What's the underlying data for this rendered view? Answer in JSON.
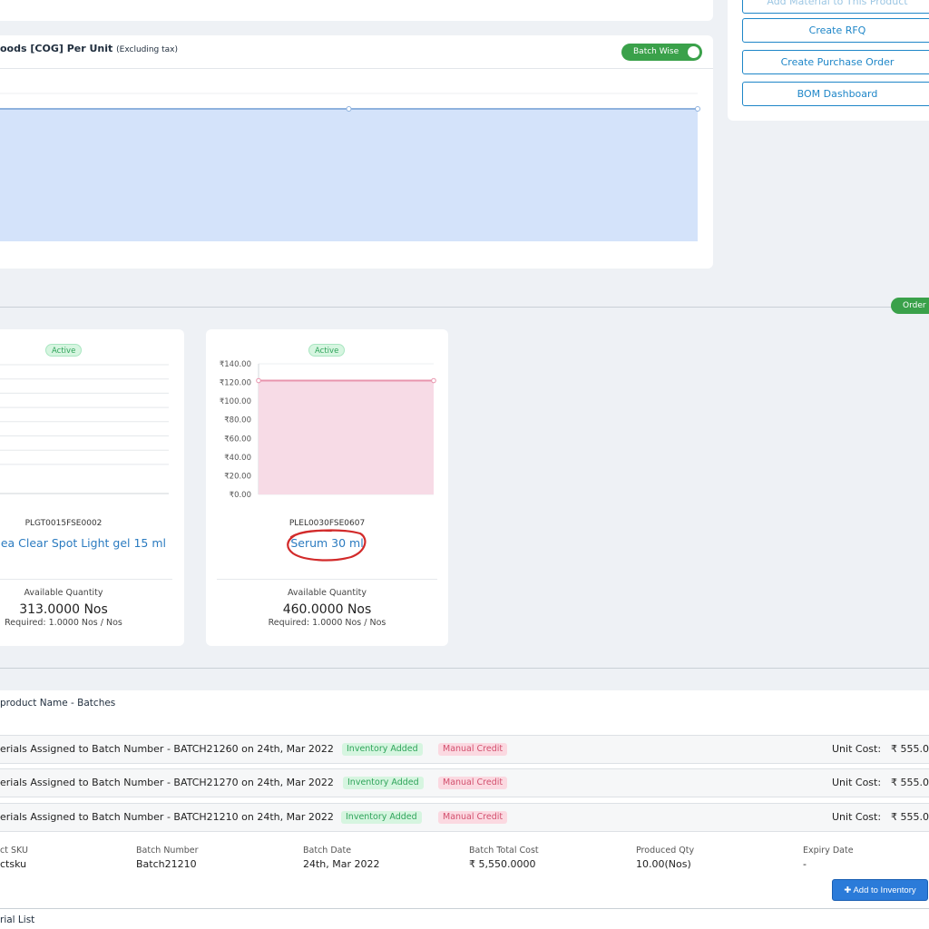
{
  "right_panel": {
    "buttons": [
      {
        "label": "Add Material to This Product"
      },
      {
        "label": "Create RFQ"
      },
      {
        "label": "Create Purchase Order"
      },
      {
        "label": "BOM Dashboard"
      }
    ]
  },
  "cog": {
    "title": "oods [COG] Per Unit",
    "subtitle": "(Excluding tax)",
    "toggle_label": "Batch Wise"
  },
  "order_pill": "Order",
  "material_cards": [
    {
      "status": "Active",
      "sku": "PLGT0015FSE0002",
      "name": "ea Clear Spot Light gel 15 ml",
      "available_label": "Available Quantity",
      "available_value": "313.0000 Nos",
      "required": "Required: 1.0000 Nos / Nos"
    },
    {
      "status": "Active",
      "sku": "PLEL0030FSE0607",
      "name": "Serum 30 ml",
      "available_label": "Available Quantity",
      "available_value": "460.0000 Nos",
      "required": "Required: 1.0000 Nos / Nos",
      "chart_ticks": [
        "₹140.00",
        "₹120.00",
        "₹100.00",
        "₹80.00",
        "₹60.00",
        "₹40.00",
        "₹20.00",
        "₹0.00"
      ]
    }
  ],
  "chart_data": [
    {
      "type": "area",
      "title": "",
      "x": [
        "",
        "",
        ""
      ],
      "series": [
        {
          "values": [
            1,
            1,
            1
          ]
        }
      ],
      "color": "#d4e3fa",
      "line_color": "#8fb2de"
    },
    {
      "type": "area",
      "title": "",
      "ylim": [
        0,
        140
      ],
      "yticks": [
        0,
        20,
        40,
        60,
        80,
        100,
        120,
        140
      ],
      "x": [
        "",
        ""
      ],
      "series": [
        {
          "values": [
            122,
            122
          ]
        }
      ],
      "color": "#f7dbe6",
      "line_color": "#e894ad"
    }
  ],
  "batches": {
    "title": "product Name - Batches",
    "rows": [
      {
        "text": "erials Assigned to Batch Number - BATCH21260 on 24th, Mar 2022",
        "badge1": "Inventory Added",
        "badge2": "Manual Credit",
        "unit_cost_label": "Unit Cost:",
        "unit_cost_value": "₹ 555.0"
      },
      {
        "text": "erials Assigned to Batch Number - BATCH21270 on 24th, Mar 2022",
        "badge1": "Inventory Added",
        "badge2": "Manual Credit",
        "unit_cost_label": "Unit Cost:",
        "unit_cost_value": "₹ 555.0"
      },
      {
        "text": "erials Assigned to Batch Number - BATCH21210 on 24th, Mar 2022",
        "badge1": "Inventory Added",
        "badge2": "Manual Credit",
        "unit_cost_label": "Unit Cost:",
        "unit_cost_value": "₹ 555.0"
      }
    ],
    "details": {
      "labels": [
        "ct SKU",
        "Batch Number",
        "Batch Date",
        "Batch Total Cost",
        "Produced Qty",
        "Expiry Date"
      ],
      "values": [
        "ctsku",
        "Batch21210",
        "24th, Mar 2022",
        "₹ 5,550.0000",
        "10.00(Nos)",
        "-"
      ]
    },
    "add_button": "Add to Inventory",
    "serial_title": "rial List"
  },
  "colors": {
    "accent_blue": "#1e86c8",
    "green": "#3aa14a",
    "primary_button": "#2b7bd9",
    "annotation_red": "#d22a2a"
  }
}
